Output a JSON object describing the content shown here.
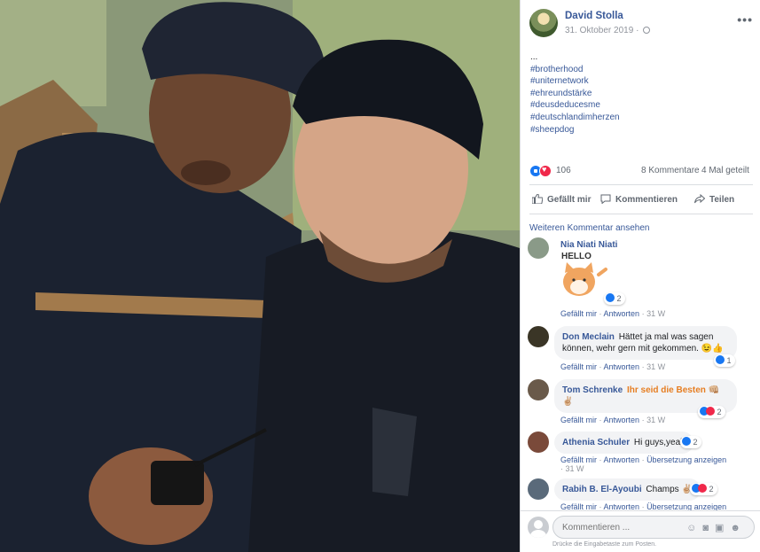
{
  "post": {
    "author": "David Stolla",
    "date": "31. Oktober 2019",
    "ellipsis": "...",
    "hashtags": [
      "#brotherhood",
      "#uniternetwork",
      "#ehreundstärke",
      "#deusdeducesme",
      "#deutschlandimherzen",
      "#sheepdog"
    ],
    "reaction_count": "106",
    "comments_count": "8 Kommentare",
    "shares_count": "4 Mal geteilt"
  },
  "actions": {
    "like": "Gefällt mir",
    "comment": "Kommentieren",
    "share": "Teilen"
  },
  "comments_section": {
    "more_label": "Weiteren Kommentar ansehen",
    "items": [
      {
        "name": "Nia Niati Niati",
        "text": "",
        "time": "31 W",
        "reactions": "2",
        "sticker_text": "HELLO"
      },
      {
        "name": "Don Meclain",
        "text": "Hättet ja mal was sagen können, wehr gern mit gekommen. 😉👍",
        "time": "31 W",
        "reactions": "1"
      },
      {
        "name": "Tom Schrenke",
        "text": "Ihr seid die Besten 👊🏼✌🏼",
        "time": "31 W",
        "reactions": "2"
      },
      {
        "name": "Athenia Schuler",
        "text": "Hi guys,yeah",
        "time": "31 W",
        "reactions": "2",
        "translate": "Übersetzung anzeigen"
      },
      {
        "name": "Rabih B. El-Ayoubi",
        "text": "Champs ✌🏼",
        "time": "",
        "reactions": "2",
        "translate": "Übersetzung anzeigen"
      }
    ],
    "like_label": "Gefällt mir",
    "reply_label": "Antworten"
  },
  "composer": {
    "placeholder": "Kommentieren ...",
    "hint": "Drücke die Eingabetaste zum Posten."
  }
}
